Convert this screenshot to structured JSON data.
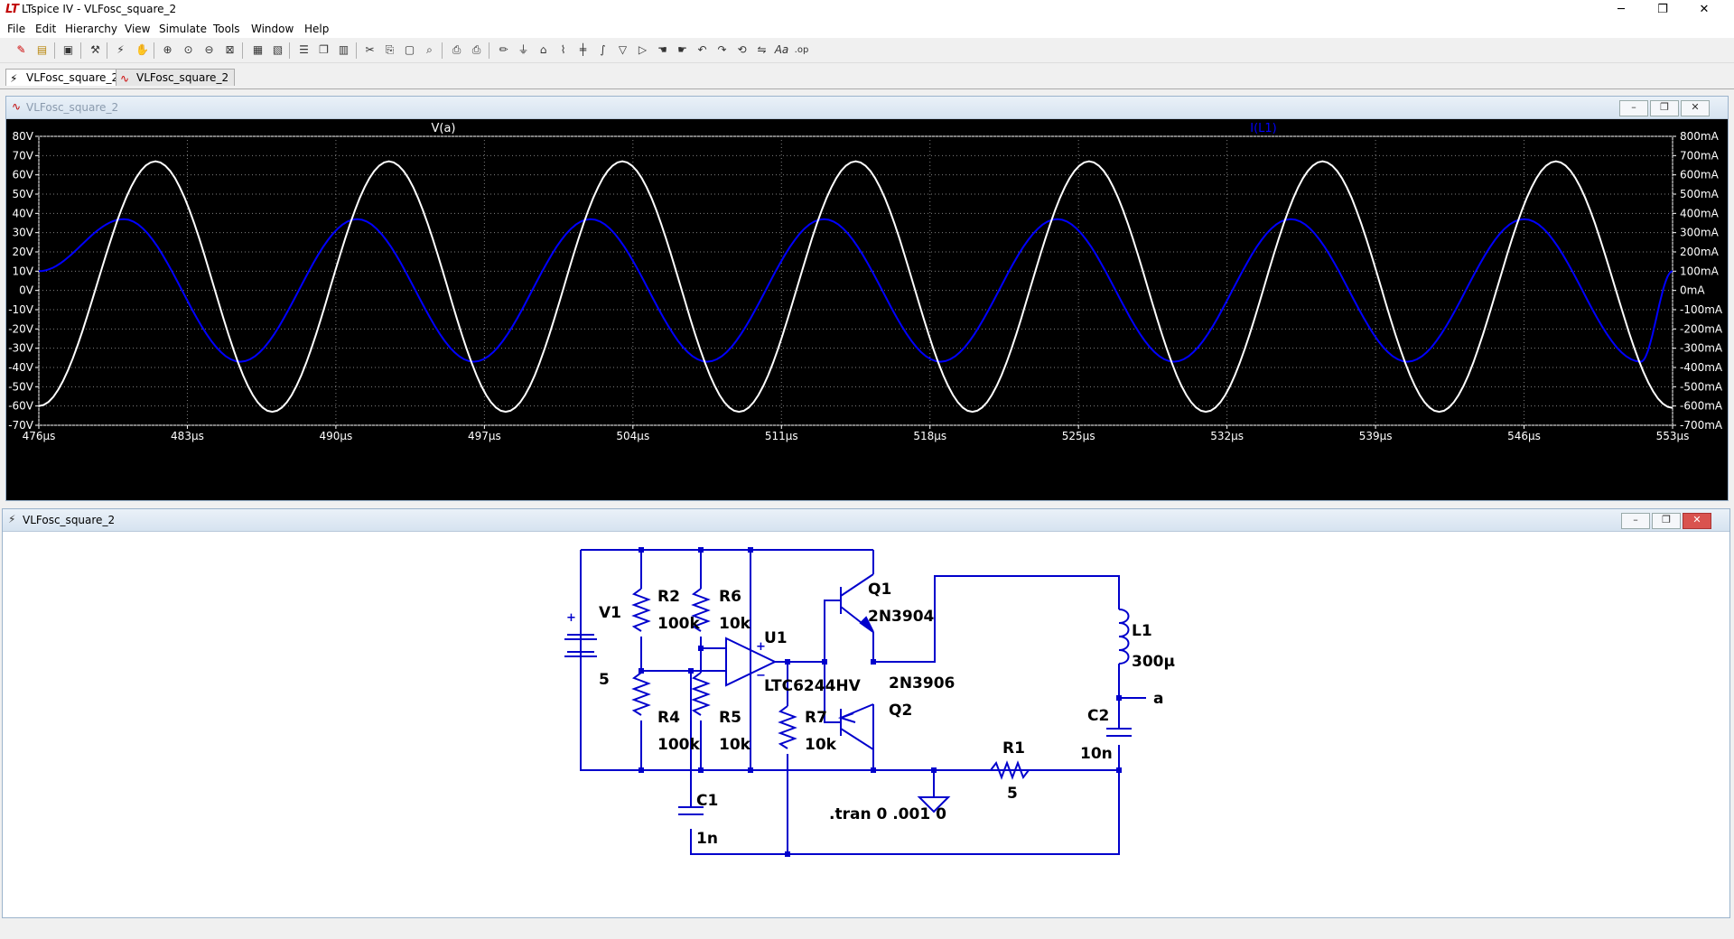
{
  "window": {
    "title": "LTspice IV - VLFosc_square_2",
    "minimize": "─",
    "maximize": "❐",
    "close": "✕"
  },
  "menu": [
    "File",
    "Edit",
    "Hierarchy",
    "View",
    "Simulate",
    "Tools",
    "Window",
    "Help"
  ],
  "toolbar_icons": [
    "new-schematic",
    "open-file",
    "save",
    "control-panel",
    "run",
    "zoom-in",
    "pan",
    "zoom-out",
    "zoom-fit",
    "autorange",
    "cascade",
    "tile-horizontal",
    "tile-vertical",
    "cut",
    "copy",
    "paste",
    "find",
    "print-preview",
    "print",
    "wire",
    "ground",
    "label-net",
    "component",
    "resistor",
    "capacitor",
    "inductor",
    "diode",
    "drag",
    "move",
    "undo",
    "redo",
    "rotate",
    "mirror",
    "text",
    "spice-directive"
  ],
  "tabs": [
    {
      "label": "VLFosc_square_2",
      "icon": "schematic-icon"
    },
    {
      "label": "VLFosc_square_2",
      "icon": "waveform-icon"
    }
  ],
  "waveform_window": {
    "title": "VLFosc_square_2",
    "colors": {
      "va": "#ffffff",
      "il1": "#0000ff",
      "grid": "#808080",
      "axis_text": "#ffffff"
    }
  },
  "schematic_window": {
    "title": "VLFosc_square_2"
  },
  "chart_data": {
    "type": "line",
    "series": [
      {
        "name": "V(a)"
      },
      {
        "name": "I(L1)"
      }
    ],
    "x_ticks": [
      "476µs",
      "483µs",
      "490µs",
      "497µs",
      "504µs",
      "511µs",
      "518µs",
      "525µs",
      "532µs",
      "539µs",
      "546µs",
      "553µs"
    ],
    "xlim": [
      476,
      553
    ],
    "y_ticks": [
      "80V",
      "70V",
      "60V",
      "50V",
      "40V",
      "30V",
      "20V",
      "10V",
      "0V",
      "-10V",
      "-20V",
      "-30V",
      "-40V",
      "-50V",
      "-60V",
      "-70V"
    ],
    "ylim": [
      -70,
      80
    ],
    "y2_ticks": [
      "800mA",
      "700mA",
      "600mA",
      "500mA",
      "400mA",
      "300mA",
      "200mA",
      "100mA",
      "0mA",
      "-100mA",
      "-200mA",
      "-300mA",
      "-400mA",
      "-500mA",
      "-600mA",
      "-700mA"
    ],
    "y2lim": [
      -700,
      800
    ],
    "va_peaks": [
      [
        481.5,
        67
      ],
      [
        487,
        -63
      ],
      [
        492.5,
        67
      ],
      [
        498,
        -63
      ],
      [
        503.5,
        67
      ],
      [
        509,
        -63
      ],
      [
        514.5,
        67
      ],
      [
        520,
        -63
      ],
      [
        525.5,
        67
      ],
      [
        531,
        -63
      ],
      [
        536.5,
        67
      ],
      [
        542,
        -63
      ],
      [
        547.5,
        67
      ],
      [
        553,
        -61
      ]
    ],
    "il1_peaks": [
      [
        476,
        100
      ],
      [
        480,
        370
      ],
      [
        485.5,
        -370
      ],
      [
        491,
        370
      ],
      [
        496.5,
        -370
      ],
      [
        502,
        370
      ],
      [
        507.5,
        -370
      ],
      [
        513,
        370
      ],
      [
        518.5,
        -370
      ],
      [
        524,
        370
      ],
      [
        529.5,
        -370
      ],
      [
        535,
        370
      ],
      [
        540.5,
        -370
      ],
      [
        546,
        370
      ],
      [
        551.5,
        -370
      ],
      [
        553,
        100
      ]
    ],
    "grid": true
  },
  "schematic": {
    "labels": {
      "v1": "V1",
      "v1_val": "5",
      "v1_plus": "+",
      "r2": "R2",
      "r2_val": "100k",
      "r6": "R6",
      "r6_val": "10k",
      "r4": "R4",
      "r4_val": "100k",
      "r5": "R5",
      "r5_val": "10k",
      "r7": "R7",
      "r7_val": "10k",
      "u1": "U1",
      "u1_val": "LTC6244HV",
      "q1": "Q1",
      "q1_val": "2N3904",
      "q2": "Q2",
      "q2_val": "2N3906",
      "l1": "L1",
      "l1_val": "300µ",
      "c1": "C1",
      "c1_val": "1n",
      "c2": "C2",
      "c2_val": "10n",
      "r1": "R1",
      "r1_val": "5",
      "net_a": "a",
      "directive": ".tran 0 .001 0",
      "opamp_plus": "+",
      "opamp_minus": "−"
    }
  }
}
